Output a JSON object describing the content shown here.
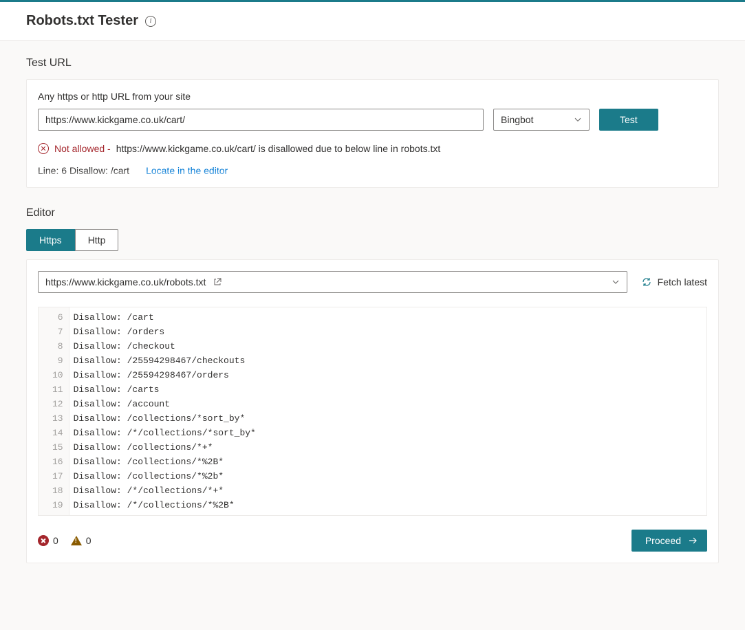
{
  "page": {
    "title": "Robots.txt Tester"
  },
  "test": {
    "section_label": "Test URL",
    "field_label": "Any https or http URL from your site",
    "url_value": "https://www.kickgame.co.uk/cart/",
    "bot_select_value": "Bingbot",
    "test_button": "Test",
    "result_status": "Not allowed -",
    "result_message": "https://www.kickgame.co.uk/cart/ is disallowed due to below line in robots.txt",
    "detail_line_prefix": "Line: 6",
    "detail_line_rule": "Disallow: /cart",
    "locate_link": "Locate in the editor"
  },
  "editor": {
    "section_label": "Editor",
    "tabs": {
      "https": "Https",
      "http": "Http"
    },
    "robots_url": "https://www.kickgame.co.uk/robots.txt",
    "fetch_label": "Fetch latest",
    "lines": [
      {
        "num": "6",
        "text": "Disallow: /cart"
      },
      {
        "num": "7",
        "text": "Disallow: /orders"
      },
      {
        "num": "8",
        "text": "Disallow: /checkout"
      },
      {
        "num": "9",
        "text": "Disallow: /25594298467/checkouts"
      },
      {
        "num": "10",
        "text": "Disallow: /25594298467/orders"
      },
      {
        "num": "11",
        "text": "Disallow: /carts"
      },
      {
        "num": "12",
        "text": "Disallow: /account"
      },
      {
        "num": "13",
        "text": "Disallow: /collections/*sort_by*"
      },
      {
        "num": "14",
        "text": "Disallow: /*/collections/*sort_by*"
      },
      {
        "num": "15",
        "text": "Disallow: /collections/*+*"
      },
      {
        "num": "16",
        "text": "Disallow: /collections/*%2B*"
      },
      {
        "num": "17",
        "text": "Disallow: /collections/*%2b*"
      },
      {
        "num": "18",
        "text": "Disallow: /*/collections/*+*"
      },
      {
        "num": "19",
        "text": "Disallow: /*/collections/*%2B*"
      }
    ],
    "error_count": "0",
    "warning_count": "0",
    "proceed_button": "Proceed"
  }
}
